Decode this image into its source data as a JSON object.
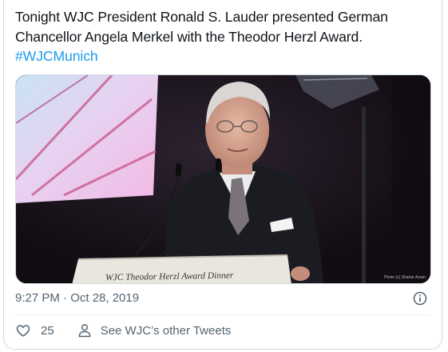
{
  "tweet": {
    "text_line1": "Tonight WJC President Ronald S. Lauder presented German",
    "text_line2": "Chancellor Angela Merkel with the Theodor Herzl Award.",
    "hashtag": "#WJCMunich"
  },
  "media": {
    "podium_sign": "WJC Theodor Herzl Award Dinner",
    "photo_credit": "Photo (c) Shahar Azran"
  },
  "meta": {
    "timestamp": "9:27 PM · Oct 28, 2019",
    "info_icon": "info-icon"
  },
  "actions": {
    "like_icon": "heart-icon",
    "like_count": "25",
    "profile_icon": "person-icon",
    "other_tweets_label": "See WJC’s other Tweets"
  },
  "colors": {
    "text": "#0f1419",
    "secondary": "#536471",
    "link": "#1d9bf0",
    "border": "#cfd9de"
  }
}
